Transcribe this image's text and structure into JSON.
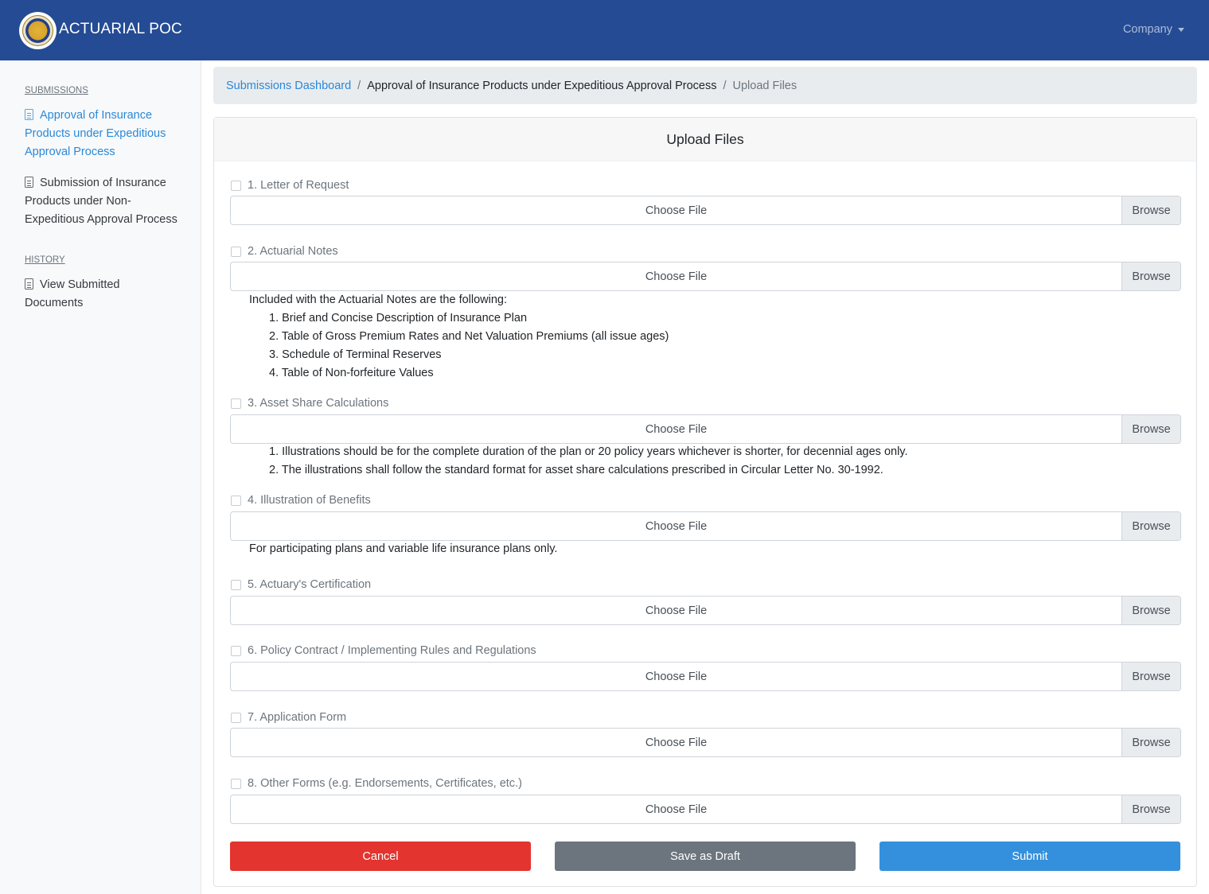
{
  "navbar": {
    "brand": "ACTUARIAL POC",
    "company_menu": "Company"
  },
  "sidebar": {
    "submissions_heading": "SUBMISSIONS",
    "items": [
      {
        "label": "Approval of Insurance Products under Expeditious Approval Process",
        "active": true
      },
      {
        "label": "Submission of Insurance Products under Non-Expeditious Approval Process",
        "active": false
      }
    ],
    "history_heading": "HISTORY",
    "history_items": [
      {
        "label": "View Submitted Documents"
      }
    ]
  },
  "breadcrumb": {
    "items": [
      "Submissions Dashboard",
      "Approval of Insurance Products under Expeditious Approval Process",
      "Upload Files"
    ]
  },
  "form": {
    "title": "Upload Files",
    "choose_file_label": "Choose File",
    "browse_label": "Browse",
    "fields": [
      {
        "label": "1. Letter of Request"
      },
      {
        "label": "2. Actuarial Notes",
        "note": "Included with the Actuarial Notes are the following:",
        "list": [
          "1. Brief and Concise Description of Insurance Plan",
          "2. Table of Gross Premium Rates and Net Valuation Premiums (all issue ages)",
          "3. Schedule of Terminal Reserves",
          "4. Table of Non-forfeiture Values"
        ]
      },
      {
        "label": "3. Asset Share Calculations",
        "list": [
          "1. Illustrations should be for the complete duration of the plan or 20 policy years whichever is shorter, for decennial ages only.",
          "2. The illustrations shall follow the standard format for asset share calculations prescribed in Circular Letter No. 30-1992."
        ]
      },
      {
        "label": "4. Illustration of Benefits",
        "note": "For participating plans and variable life insurance plans only."
      },
      {
        "label": "5. Actuary's Certification"
      },
      {
        "label": "6. Policy Contract / Implementing Rules and Regulations"
      },
      {
        "label": "7. Application Form"
      },
      {
        "label": "8. Other Forms (e.g. Endorsements, Certificates, etc.)"
      }
    ],
    "buttons": {
      "cancel": "Cancel",
      "save_draft": "Save as Draft",
      "submit": "Submit"
    }
  },
  "colors": {
    "navbar": "#244b94",
    "link": "#2a88d8",
    "cancel": "#e3342f",
    "draft": "#6c757d",
    "submit": "#3490dc"
  }
}
